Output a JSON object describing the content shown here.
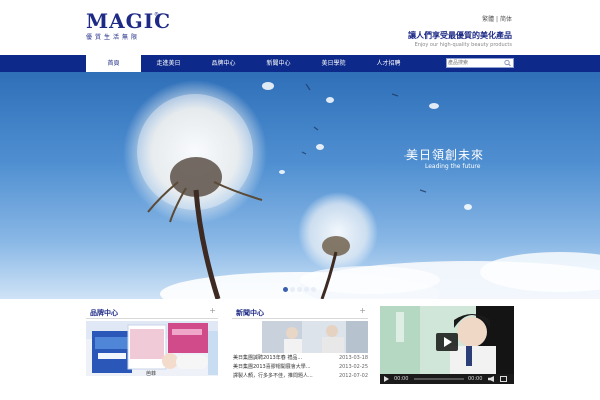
{
  "header": {
    "logo_text": "MAGIC",
    "logo_reg": "®",
    "logo_subtitle": "優質生活無限",
    "lang_traditional": "繁體",
    "lang_separator": "|",
    "lang_simplified": "简体",
    "slogan_main": "讓人們享受最優質的美化產品",
    "slogan_sub": "Enjoy our high-quality beauty products"
  },
  "nav": {
    "items": [
      {
        "label": "首頁"
      },
      {
        "label": "走進美日"
      },
      {
        "label": "品牌中心"
      },
      {
        "label": "新聞中心"
      },
      {
        "label": "美日學院"
      },
      {
        "label": "人才招聘"
      }
    ],
    "active_index": 0,
    "search_placeholder": "產品搜索"
  },
  "banner": {
    "title": "美日領創未來",
    "subtitle": "Leading the future",
    "dot_count": 5,
    "active_dot": 0
  },
  "brand": {
    "title": "品牌中心",
    "caption": "芭菲"
  },
  "news": {
    "title": "新聞中心",
    "items": [
      {
        "title": "美日集團誠聘2013年春 禮品...",
        "date": "2013-03-18"
      },
      {
        "title": "美日集團2013喜膠帽開展會大學...",
        "date": "2013-02-25"
      },
      {
        "title": "譯製人顏，行多多不佳，推問題人...",
        "date": "2012-07-02"
      }
    ]
  },
  "video": {
    "current_time": "00:00",
    "total_time": "00:00"
  },
  "colors": {
    "brand_blue": "#1d2a86",
    "nav_blue": "#0d2a8a"
  }
}
